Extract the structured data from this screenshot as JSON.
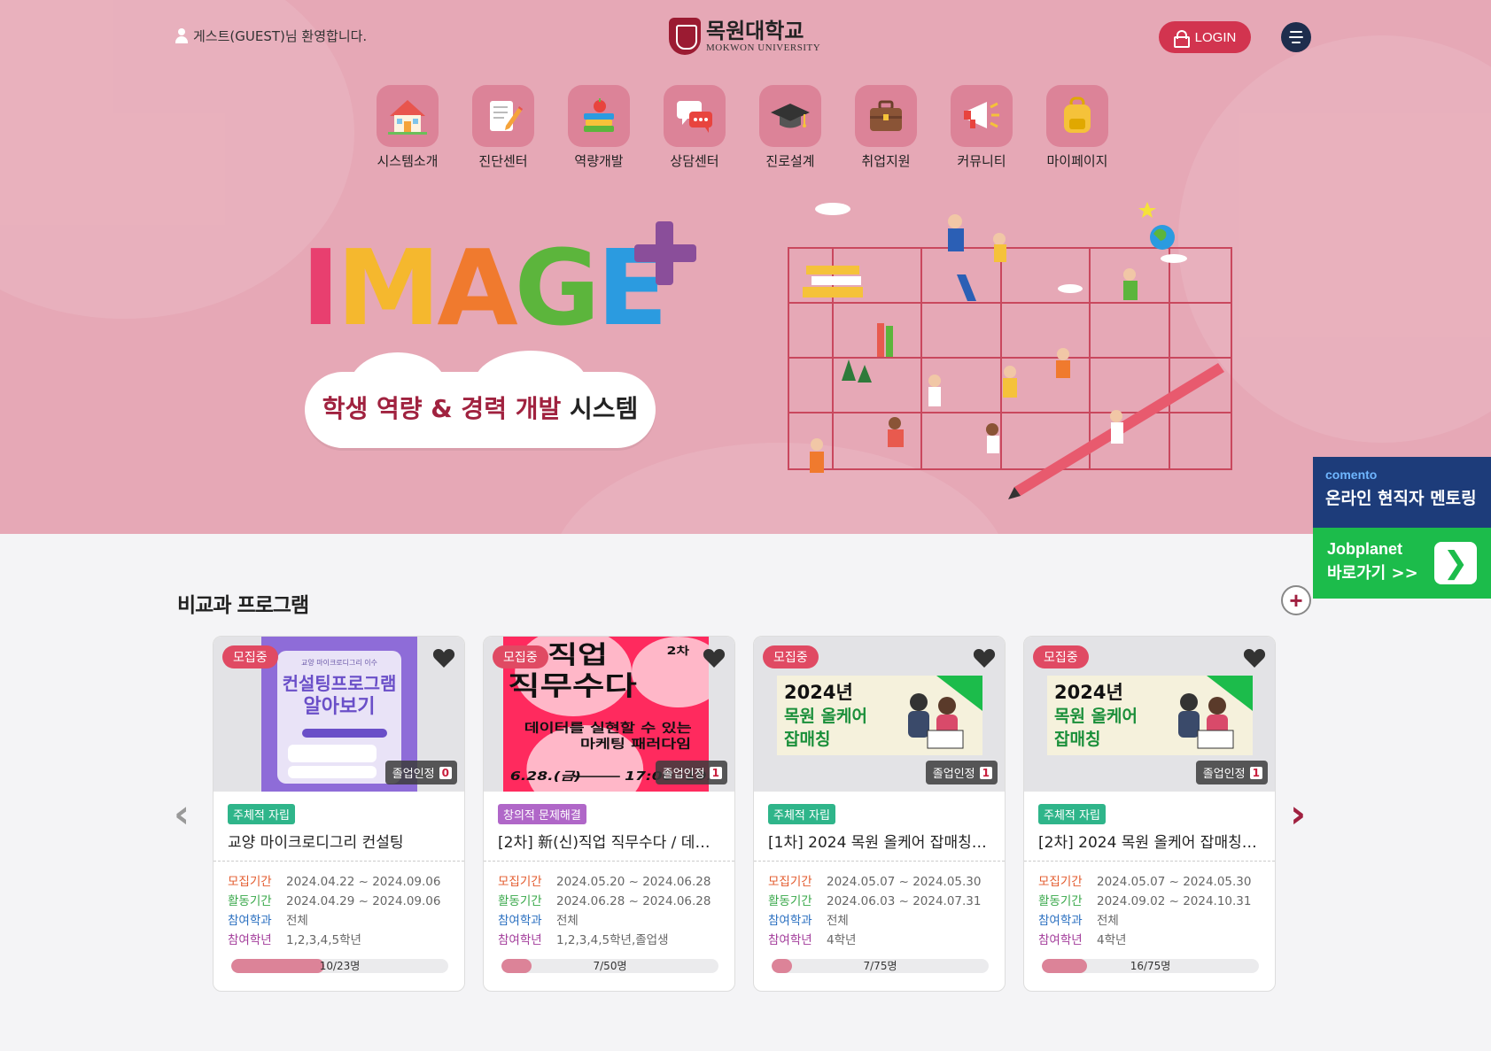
{
  "header": {
    "welcome_text": "게스트(GUEST)님 환영합니다.",
    "logo_ko": "목원대학교",
    "logo_en": "MOKWON UNIVERSITY",
    "login_label": "LOGIN"
  },
  "nav": [
    {
      "label": "시스템소개",
      "icon": "house-icon"
    },
    {
      "label": "진단센터",
      "icon": "notepad-pencil-icon"
    },
    {
      "label": "역량개발",
      "icon": "books-apple-icon"
    },
    {
      "label": "상담센터",
      "icon": "speech-bubbles-icon"
    },
    {
      "label": "진로설계",
      "icon": "graduation-cap-icon"
    },
    {
      "label": "취업지원",
      "icon": "briefcase-icon"
    },
    {
      "label": "커뮤니티",
      "icon": "megaphone-icon"
    },
    {
      "label": "마이페이지",
      "icon": "backpack-icon"
    }
  ],
  "hero": {
    "title_letters": [
      "I",
      "M",
      "A",
      "G",
      "E"
    ],
    "title_colors": [
      "#e83f6f",
      "#f5b82e",
      "#f07a2e",
      "#5cb53c",
      "#2b9be0"
    ],
    "subtitle_accent": "학생 역량 & 경력 개발",
    "subtitle_rest": " 시스템"
  },
  "side": {
    "comento_brand": "comento",
    "comento_text": "온라인 현직자 멘토링",
    "jobplanet_brand": "Jobplanet",
    "jobplanet_text": "바로가기 >>"
  },
  "section": {
    "title": "비교과 프로그램"
  },
  "labels": {
    "recruit_period": "모집기간",
    "activity_period": "활동기간",
    "dept": "참여학과",
    "grade": "참여학년",
    "recruiting": "모집중",
    "grad_cert": "졸업인정"
  },
  "cards": [
    {
      "category": "주체적 자립",
      "category_color": "#2fb58a",
      "title": "교양 마이크로디그리 컨설팅",
      "recruit_period": "2024.04.22 ~ 2024.09.06",
      "activity_period": "2024.04.29 ~ 2024.09.06",
      "dept": "전체",
      "grade": "1,2,3,4,5학년",
      "grad_count": "0",
      "progress_text": "10/23명",
      "progress": 0.43,
      "poster_line1": "컨설팅프로그램",
      "poster_line2": "알아보기",
      "poster_top": "교양 마이크로디그리 이수"
    },
    {
      "category": "창의적 문제해결",
      "category_color": "#b067c8",
      "title": "[2차] 新(신)직업 직무수다 / 데…",
      "recruit_period": "2024.05.20 ~ 2024.06.28",
      "activity_period": "2024.06.28 ~ 2024.06.28",
      "dept": "전체",
      "grade": "1,2,3,4,5학년,졸업생",
      "grad_count": "1",
      "progress_text": "7/50명",
      "progress": 0.14,
      "poster_line1": "직업",
      "poster_line2": "직무수다",
      "poster_line3": "데이터를 실현할 수 있는",
      "poster_line4": "마케팅 패러다임",
      "poster_date": "6.28.(금)",
      "poster_time": "17:00~19:00",
      "poster_round": "2차"
    },
    {
      "category": "주체적 자립",
      "category_color": "#2fb58a",
      "title": "[1차] 2024 목원 올케어 잡매칭 …",
      "recruit_period": "2024.05.07 ~ 2024.05.30",
      "activity_period": "2024.06.03 ~ 2024.07.31",
      "dept": "전체",
      "grade": "4학년",
      "grad_count": "1",
      "progress_text": "7/75명",
      "progress": 0.093,
      "poster_line1": "2024년",
      "poster_line2": "목원 올케어",
      "poster_line3": "잡매칭"
    },
    {
      "category": "주체적 자립",
      "category_color": "#2fb58a",
      "title": "[2차] 2024 목원 올케어 잡매칭 …",
      "recruit_period": "2024.05.07 ~ 2024.05.30",
      "activity_period": "2024.09.02 ~ 2024.10.31",
      "dept": "전체",
      "grade": "4학년",
      "grad_count": "1",
      "progress_text": "16/75명",
      "progress": 0.21,
      "poster_line1": "2024년",
      "poster_line2": "목원 올케어",
      "poster_line3": "잡매칭"
    }
  ]
}
